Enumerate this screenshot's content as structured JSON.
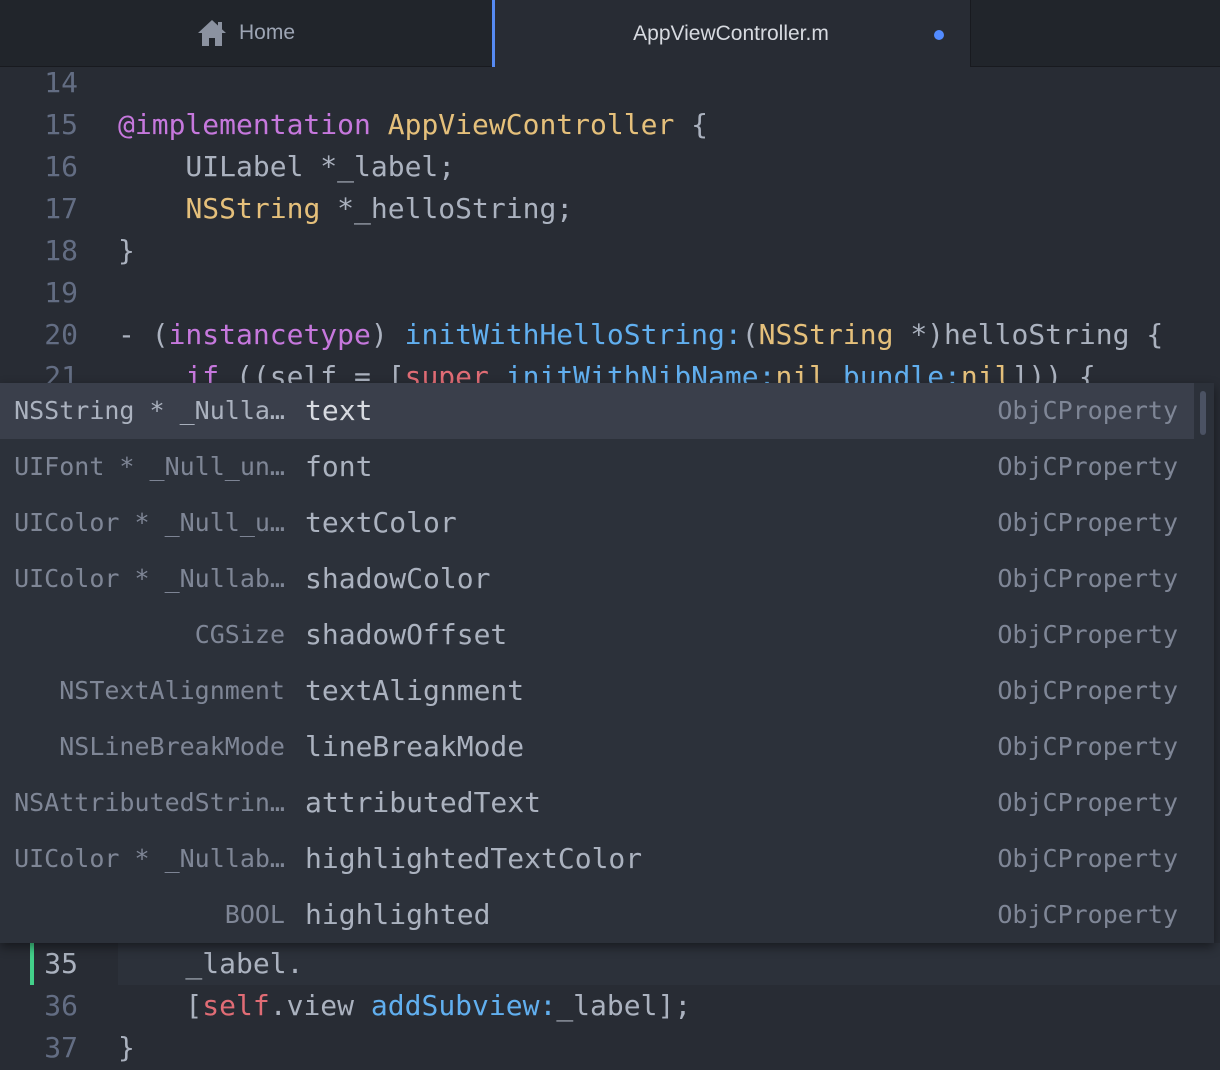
{
  "tabs": [
    {
      "label": "Home",
      "icon": "home-icon"
    },
    {
      "label": "AppViewController.m",
      "modified": true
    }
  ],
  "code_lines": [
    {
      "num": "14",
      "tokens": []
    },
    {
      "num": "15",
      "tokens": [
        {
          "t": "@implementation",
          "c": "kw"
        },
        {
          "t": " ",
          "c": "pl"
        },
        {
          "t": "AppViewController",
          "c": "ty"
        },
        {
          "t": " {",
          "c": "pl"
        }
      ]
    },
    {
      "num": "16",
      "tokens": [
        {
          "t": "    UILabel *_label;",
          "c": "pl"
        }
      ]
    },
    {
      "num": "17",
      "tokens": [
        {
          "t": "    ",
          "c": "pl"
        },
        {
          "t": "NSString",
          "c": "ty"
        },
        {
          "t": " *_helloString;",
          "c": "pl"
        }
      ]
    },
    {
      "num": "18",
      "tokens": [
        {
          "t": "}",
          "c": "pl"
        }
      ]
    },
    {
      "num": "19",
      "tokens": []
    },
    {
      "num": "20",
      "tokens": [
        {
          "t": "- (",
          "c": "pl"
        },
        {
          "t": "instancetype",
          "c": "kw"
        },
        {
          "t": ") ",
          "c": "pl"
        },
        {
          "t": "initWithHelloString:",
          "c": "fn"
        },
        {
          "t": "(",
          "c": "pl"
        },
        {
          "t": "NSString",
          "c": "ty"
        },
        {
          "t": " *)helloString {",
          "c": "pl"
        }
      ]
    },
    {
      "num": "21",
      "tokens": [
        {
          "t": "    ",
          "c": "pl"
        },
        {
          "t": "if",
          "c": "kw"
        },
        {
          "t": " ((self = [",
          "c": "pl"
        },
        {
          "t": "super",
          "c": "sf"
        },
        {
          "t": " ",
          "c": "pl"
        },
        {
          "t": "initWithNibName:",
          "c": "fn"
        },
        {
          "t": "nil",
          "c": "ty"
        },
        {
          "t": " ",
          "c": "pl"
        },
        {
          "t": "bundle:",
          "c": "fn"
        },
        {
          "t": "nil",
          "c": "ty"
        },
        {
          "t": "])) {",
          "c": "pl"
        }
      ]
    }
  ],
  "bottom_lines": [
    {
      "num": "35",
      "cursor": true,
      "tokens": [
        {
          "t": "    _label.",
          "c": "pl"
        }
      ]
    },
    {
      "num": "36",
      "tokens": [
        {
          "t": "    [",
          "c": "pl"
        },
        {
          "t": "self",
          "c": "sf"
        },
        {
          "t": ".view ",
          "c": "pl"
        },
        {
          "t": "addSubview:",
          "c": "fn"
        },
        {
          "t": "_label];",
          "c": "pl"
        }
      ]
    },
    {
      "num": "37",
      "tokens": [
        {
          "t": "}",
          "c": "pl"
        }
      ]
    }
  ],
  "autocomplete": [
    {
      "type": "NSString * _Nulla…",
      "name": "text",
      "kind": "ObjCProperty",
      "selected": true
    },
    {
      "type": "UIFont * _Null_un…",
      "name": "font",
      "kind": "ObjCProperty"
    },
    {
      "type": "UIColor * _Null_u…",
      "name": "textColor",
      "kind": "ObjCProperty"
    },
    {
      "type": "UIColor * _Nullab…",
      "name": "shadowColor",
      "kind": "ObjCProperty"
    },
    {
      "type": "CGSize",
      "name": "shadowOffset",
      "kind": "ObjCProperty"
    },
    {
      "type": "NSTextAlignment",
      "name": "textAlignment",
      "kind": "ObjCProperty"
    },
    {
      "type": "NSLineBreakMode",
      "name": "lineBreakMode",
      "kind": "ObjCProperty"
    },
    {
      "type": "NSAttributedStrin…",
      "name": "attributedText",
      "kind": "ObjCProperty"
    },
    {
      "type": "UIColor * _Nullab…",
      "name": "highlightedTextColor",
      "kind": "ObjCProperty"
    },
    {
      "type": "BOOL",
      "name": "highlighted",
      "kind": "ObjCProperty"
    }
  ],
  "colors": {
    "background": "#282c34",
    "tab_accent": "#568af2",
    "keyword": "#c678dd",
    "type": "#e5c07b",
    "function": "#61afef",
    "self": "#e06c75",
    "cursor_marker": "#43d08a"
  }
}
